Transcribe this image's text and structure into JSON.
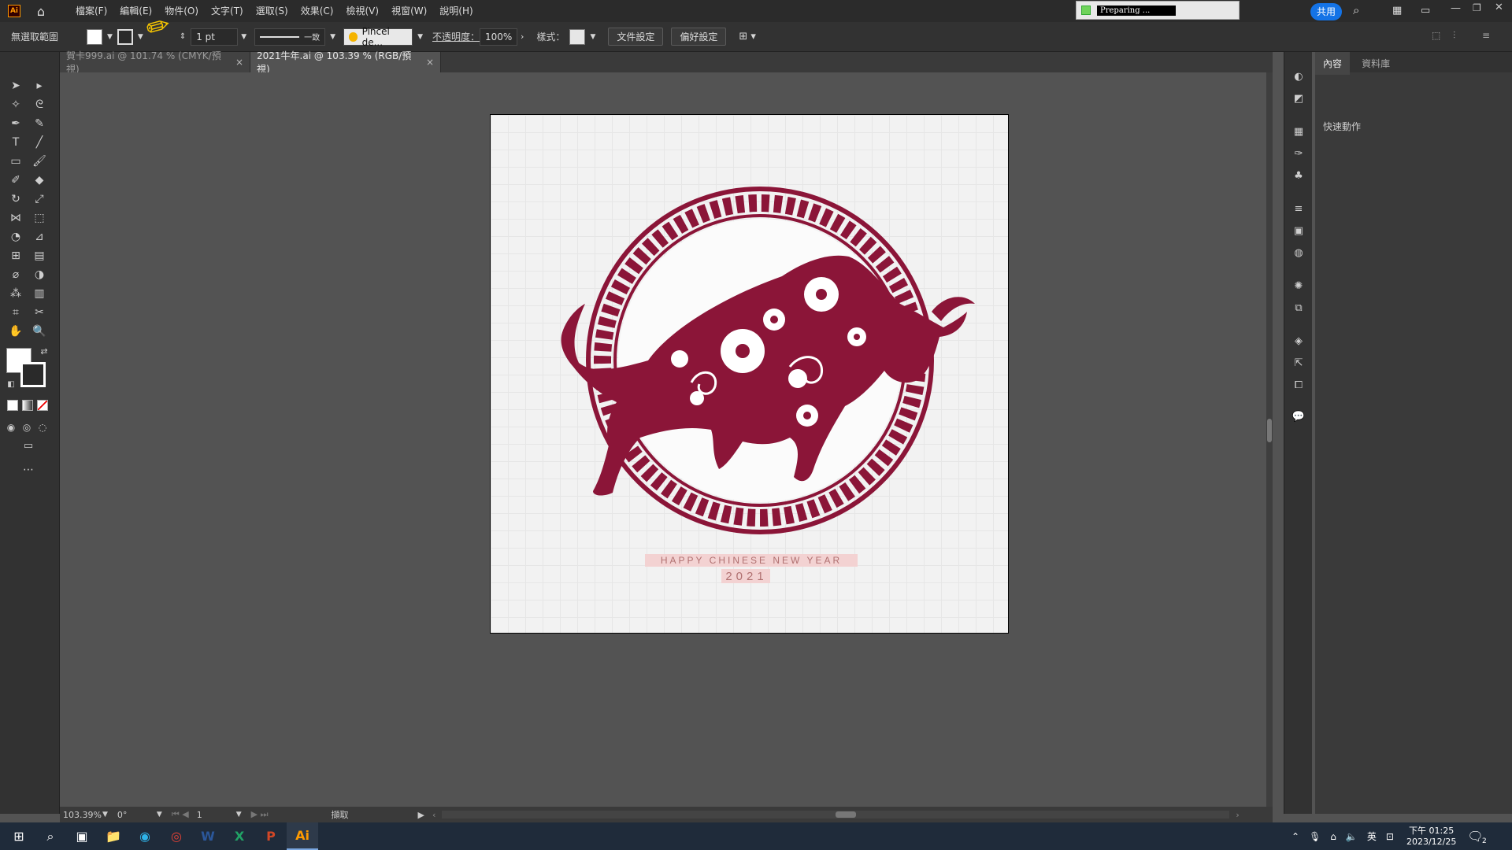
{
  "menubar": {
    "app_logo": "Ai",
    "items": [
      "檔案(F)",
      "編輯(E)",
      "物件(O)",
      "文字(T)",
      "選取(S)",
      "效果(C)",
      "檢視(V)",
      "視窗(W)",
      "說明(H)"
    ],
    "status_text": "Preparing ...",
    "share_label": "共用"
  },
  "controlbar": {
    "selection_label": "無選取範圍",
    "stroke_weight": "1 pt",
    "stroke_profile": "一致",
    "brush_name": "Pincel de...",
    "opacity_label": "不透明度：",
    "opacity_value": "100%",
    "style_label": "樣式：",
    "doc_setup_label": "文件設定",
    "preferences_label": "偏好設定"
  },
  "tabs": [
    {
      "label": "賀卡999.ai @ 101.74 % (CMYK/預視)",
      "close": "×"
    },
    {
      "label": "2021牛年.ai @ 103.39 % (RGB/預視)",
      "close": "×"
    }
  ],
  "artwork": {
    "line1": "HAPPY CHINESE NEW YEAR",
    "line2": "2021",
    "accent_color": "#8b1538"
  },
  "statusbar": {
    "zoom": "103.39%",
    "rotation": "0°",
    "artboard_num": "1",
    "mode_label": "擷取"
  },
  "panel": {
    "tab_properties": "內容",
    "tab_libraries": "資料庫",
    "quick_actions": "快速動作"
  },
  "taskbar": {
    "time": "下午 01:25",
    "date": "2023/12/25",
    "ime": "英",
    "notifications": "2"
  }
}
